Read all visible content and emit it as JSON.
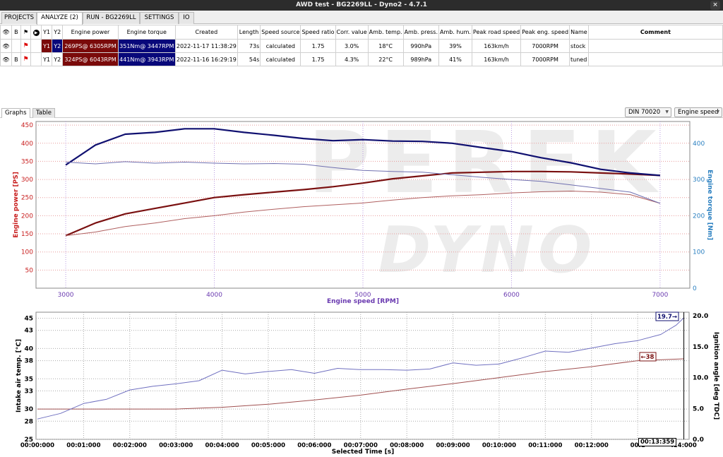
{
  "window": {
    "title": "AWD test - BG2269LL - Dyno2 - 4.7.1",
    "close_label": "×"
  },
  "topnav": {
    "tabs": [
      "PROJECTS",
      "ANALYZE (2)",
      "RUN - BG2269LL",
      "SETTINGS",
      "IO"
    ],
    "active": 1
  },
  "table": {
    "headers": [
      "",
      "B",
      "⚑",
      "",
      "Y1",
      "Y2",
      "Engine power",
      "Engine torque",
      "Created",
      "Length",
      "Speed source",
      "Speed ratio",
      "Corr. value",
      "Amb. temp.",
      "Amb. press.",
      "Amb. hum.",
      "Peak road speed",
      "Peak eng. speed",
      "Name",
      "Comment"
    ],
    "rows": [
      {
        "b": "",
        "flag": "⚑",
        "y1": "Y1",
        "y2": "Y2",
        "power": "269PS@ 6305RPM",
        "torque": "351Nm@ 3447RPM",
        "created": "2022-11-17 11:38:29",
        "length": "73s",
        "speed_source": "calculated",
        "speed_ratio": "1.75",
        "corr": "3.0%",
        "amb_temp": "18°C",
        "amb_press": "990hPa",
        "amb_hum": "39%",
        "peak_road": "163km/h",
        "peak_eng": "7000RPM",
        "name": "stock",
        "comment": ""
      },
      {
        "b": "B",
        "flag": "⚑",
        "y1": "Y1",
        "y2": "Y2",
        "power": "324PS@ 6043RPM",
        "torque": "441Nm@ 3943RPM",
        "created": "2022-11-16 16:29:19",
        "length": "54s",
        "speed_source": "calculated",
        "speed_ratio": "1.75",
        "corr": "4.3%",
        "amb_temp": "22°C",
        "amb_press": "989hPa",
        "amb_hum": "41%",
        "peak_road": "163km/h",
        "peak_eng": "7000RPM",
        "name": "tuned",
        "comment": ""
      }
    ]
  },
  "graph_tabs": [
    "Graphs",
    "Table"
  ],
  "combos": {
    "standard": "DIN 70020",
    "xaxis": "Engine speed"
  },
  "watermark": {
    "top": "PEREK",
    "bottom": "DYNO"
  },
  "chart_data": [
    {
      "type": "line",
      "xlabel": "Engine speed [RPM]",
      "ylabel": "Engine power [PS]",
      "y2label": "Engine torque [Nm]",
      "xlim": [
        2800,
        7200
      ],
      "ylim": [
        0,
        460
      ],
      "y2lim": [
        0,
        460
      ],
      "xticks": [
        3000,
        4000,
        5000,
        6000,
        7000
      ],
      "yticks": [
        50,
        100,
        150,
        200,
        250,
        300,
        350,
        400,
        450
      ],
      "y2ticks": [
        0,
        100,
        200,
        300,
        400
      ],
      "colors": {
        "power_axis": "#c81e1e",
        "torque_axis": "#2a7fc0",
        "xlabel": "#6a3ab0",
        "power_tuned": "#7a1010",
        "power_stock": "#b06060",
        "torque_tuned": "#101070",
        "torque_stock": "#7070b0"
      },
      "series": [
        {
          "name": "tuned",
          "axis": "y1",
          "x": [
            3000,
            3200,
            3400,
            3600,
            3800,
            4000,
            4200,
            4400,
            4600,
            4800,
            5000,
            5200,
            5400,
            5600,
            5800,
            6000,
            6200,
            6400,
            6600,
            6800,
            7000
          ],
          "values": [
            145,
            180,
            205,
            220,
            235,
            250,
            258,
            265,
            272,
            280,
            290,
            302,
            310,
            318,
            320,
            322,
            322,
            321,
            318,
            315,
            311
          ]
        },
        {
          "name": "stock",
          "axis": "y1",
          "x": [
            3000,
            3200,
            3400,
            3600,
            3800,
            4000,
            4200,
            4400,
            4600,
            4800,
            5000,
            5200,
            5400,
            5600,
            5800,
            6000,
            6200,
            6400,
            6600,
            6800,
            7000
          ],
          "values": [
            145,
            155,
            170,
            180,
            192,
            200,
            210,
            218,
            225,
            230,
            235,
            243,
            250,
            255,
            258,
            263,
            266,
            268,
            265,
            258,
            234
          ]
        },
        {
          "name": "tuned",
          "axis": "y2",
          "x": [
            3000,
            3200,
            3400,
            3600,
            3800,
            4000,
            4200,
            4400,
            4600,
            4800,
            5000,
            5200,
            5400,
            5600,
            5800,
            6000,
            6200,
            6400,
            6600,
            6800,
            7000
          ],
          "values": [
            340,
            395,
            425,
            430,
            440,
            440,
            430,
            422,
            413,
            407,
            410,
            406,
            405,
            400,
            388,
            377,
            360,
            346,
            328,
            318,
            311
          ]
        },
        {
          "name": "stock",
          "axis": "y2",
          "x": [
            3000,
            3200,
            3400,
            3600,
            3800,
            4000,
            4200,
            4400,
            4600,
            4800,
            5000,
            5200,
            5400,
            5600,
            5800,
            6000,
            6200,
            6400,
            6600,
            6800,
            7000
          ],
          "values": [
            348,
            343,
            349,
            345,
            348,
            345,
            343,
            344,
            342,
            333,
            325,
            322,
            320,
            313,
            306,
            300,
            295,
            285,
            275,
            265,
            234
          ]
        }
      ]
    },
    {
      "type": "line",
      "xlabel": "Selected Time [s]",
      "ylabel": "Intake air temp. [°C]",
      "y2label": "Ignition angle [deg TDC]",
      "xlim": [
        0,
        845
      ],
      "ylim": [
        25,
        46
      ],
      "y2lim": [
        0,
        20.6
      ],
      "xticks": [
        "00:00:000",
        "00:01:000",
        "00:02:000",
        "00:03:000",
        "00:04:000",
        "00:05:000",
        "00:06:000",
        "00:07:000",
        "00:08:000",
        "00:09:000",
        "00:10:000",
        "00:11:000",
        "00:12:000",
        "00:1",
        "00:13:359",
        ":14:000"
      ],
      "yticks": [
        25,
        28,
        30,
        33,
        35,
        38,
        40,
        43,
        45
      ],
      "y2ticks": [
        0.0,
        5.0,
        10.0,
        15.0,
        20.0
      ],
      "cursor": {
        "time": "00:13:359",
        "intake_label": "←38",
        "ignition_label": "19.7→"
      },
      "colors": {
        "intake": "#a05050",
        "ignition": "#7070c0",
        "intake_box": "#7a1010",
        "ignition_box": "#101070"
      },
      "series": [
        {
          "name": "intake",
          "axis": "y1",
          "x": [
            0,
            60,
            120,
            180,
            240,
            300,
            360,
            420,
            480,
            540,
            600,
            660,
            720,
            780,
            820,
            840
          ],
          "values": [
            30,
            30,
            30,
            30,
            30.3,
            30.8,
            31.5,
            32.3,
            33.3,
            34.2,
            35.2,
            36.2,
            37.0,
            38.0,
            38.2,
            38.3
          ]
        },
        {
          "name": "ignition",
          "axis": "y2",
          "x": [
            0,
            30,
            60,
            90,
            120,
            150,
            180,
            210,
            240,
            270,
            300,
            330,
            360,
            390,
            420,
            450,
            480,
            510,
            540,
            570,
            600,
            630,
            660,
            690,
            720,
            750,
            780,
            810,
            830,
            840
          ],
          "values": [
            3.3,
            4.2,
            5.8,
            6.5,
            8.0,
            8.6,
            9.0,
            9.5,
            11.2,
            10.6,
            11.0,
            11.3,
            10.7,
            11.5,
            11.3,
            11.3,
            11.2,
            11.4,
            12.4,
            12.0,
            12.2,
            13.2,
            14.3,
            14.1,
            14.8,
            15.5,
            16.0,
            17.0,
            18.5,
            19.7
          ]
        }
      ]
    }
  ]
}
